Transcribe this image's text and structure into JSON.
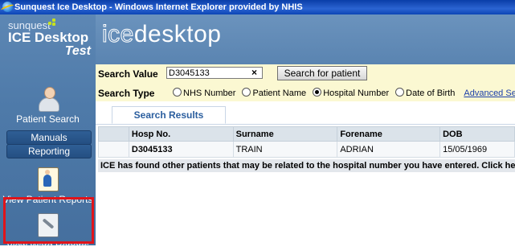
{
  "window": {
    "title": "Sunquest Ice Desktop - Windows Internet Explorer provided by NHIS"
  },
  "sidebar": {
    "logo_sub": "sunquest",
    "logo_main": "ICE Desktop",
    "logo_test": "Test",
    "patient_search": "Patient Search",
    "manuals": "Manuals",
    "reporting": "Reporting",
    "view_patient_reports": "View Patient Reports",
    "view_ward_reports": "View Ward Reports"
  },
  "header": {
    "brand_ice": "ice",
    "brand_desktop": "desktop"
  },
  "search": {
    "value_label": "Search Value",
    "value": "D3045133",
    "clear_symbol": "×",
    "button_label": "Search for patient",
    "type_label": "Search Type",
    "options": [
      "NHS Number",
      "Patient Name",
      "Hospital Number",
      "Date of Birth"
    ],
    "selected_option": "Hospital Number",
    "advanced_link": "Advanced Search"
  },
  "tabs": {
    "search_results": "Search Results"
  },
  "results": {
    "columns": [
      "",
      "Hosp No.",
      "Surname",
      "Forename",
      "DOB"
    ],
    "rows": [
      [
        "",
        "D3045133",
        "TRAIN",
        "ADRIAN",
        "15/05/1969"
      ]
    ],
    "notice": "ICE has found other patients that may be related to the hospital number you have entered. Click here"
  },
  "colors": {
    "title_bar": "#0c45b5",
    "sidebar": "#4e7aa9",
    "search_panel": "#fbf8d2",
    "highlight": "#e0141a"
  }
}
